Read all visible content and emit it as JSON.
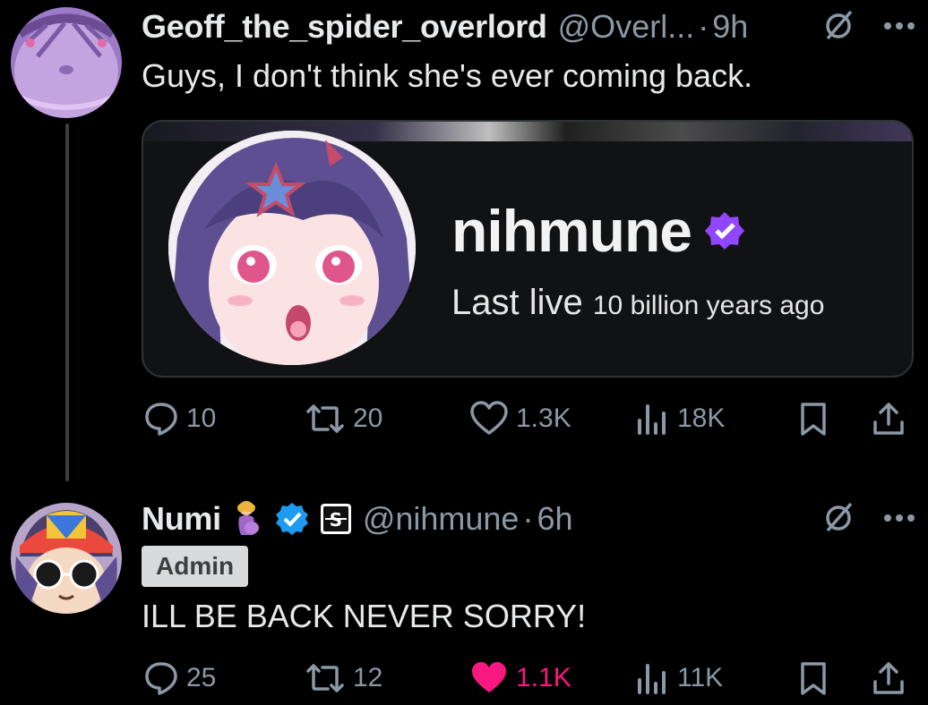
{
  "tweet1": {
    "display_name": "Geoff_the_spider_overlord",
    "handle": "@Overl...",
    "time": "9h",
    "separator": "·",
    "text": "Guys, I don't think she's ever coming back.",
    "card": {
      "name": "nihmune",
      "last_live_label": "Last live",
      "last_live_value": "10 billion years ago"
    },
    "stats": {
      "replies": "10",
      "reposts": "20",
      "likes": "1.3K",
      "views": "18K"
    }
  },
  "tweet2": {
    "display_name": "Numi",
    "handle": "@nihmune",
    "time": "6h",
    "separator": "·",
    "badge": "Admin",
    "affiliate_mark": "S",
    "text": "ILL BE BACK NEVER SORRY!",
    "stats": {
      "replies": "25",
      "reposts": "12",
      "likes": "1.1K",
      "views": "11K"
    },
    "liked": true
  },
  "colors": {
    "background": "#000000",
    "text": "#e7e9ea",
    "muted": "#8b98a5",
    "verified_blue": "#1d9bf0",
    "twitch_purple": "#9147ff",
    "like_pink": "#f91880"
  },
  "icons": [
    "reply-icon",
    "repost-icon",
    "like-icon",
    "views-icon",
    "bookmark-icon",
    "share-icon",
    "grok-icon",
    "more-icon",
    "verified-icon"
  ]
}
